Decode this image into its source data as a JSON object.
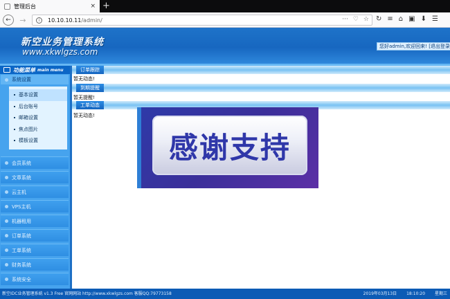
{
  "browser": {
    "tab_title": "管理后台",
    "tab_close": "×",
    "new_tab": "+",
    "url_host": "10.10.10.11",
    "url_path": "/admin/",
    "back": "←",
    "forward": "→",
    "url_actions": [
      "···",
      "♡",
      "☆"
    ],
    "toolbar_icons": [
      "↻",
      "≡",
      "⌂",
      "▣",
      "⬇",
      "☰"
    ]
  },
  "header": {
    "brand": "新空业务管理系统",
    "brand_url": "www.xkwlgzs.com",
    "welcome": "您好admin,欢迎回来! [退出登录]"
  },
  "sidebar": {
    "menu_title": "功能菜单",
    "menu_title_en": "main menu",
    "section": "系统设置",
    "submenu": [
      "基本设置",
      "后台账号",
      "邮箱设置",
      "焦点图片",
      "模板设置"
    ],
    "items": [
      "会员系统",
      "文章系统",
      "云主机",
      "VPS主机",
      "机器租用",
      "订单系统",
      "工单系统",
      "财务系统",
      "系统安全"
    ]
  },
  "panels": [
    {
      "title": "订单跟踪",
      "body": "暂无动态!"
    },
    {
      "title": "到期提醒",
      "body": "暂无提醒!"
    },
    {
      "title": "工单动态",
      "body": "暂无动态!"
    }
  ],
  "overlay": {
    "text": "感谢支持"
  },
  "footer": {
    "left": "新空IDC业务管理系统 v1.3 Free 官网网站 http://www.xkwlgzs.com 客服QQ:79773158",
    "date": "2019年03月13日",
    "time": "18:10:20",
    "weekday": "星期三"
  }
}
